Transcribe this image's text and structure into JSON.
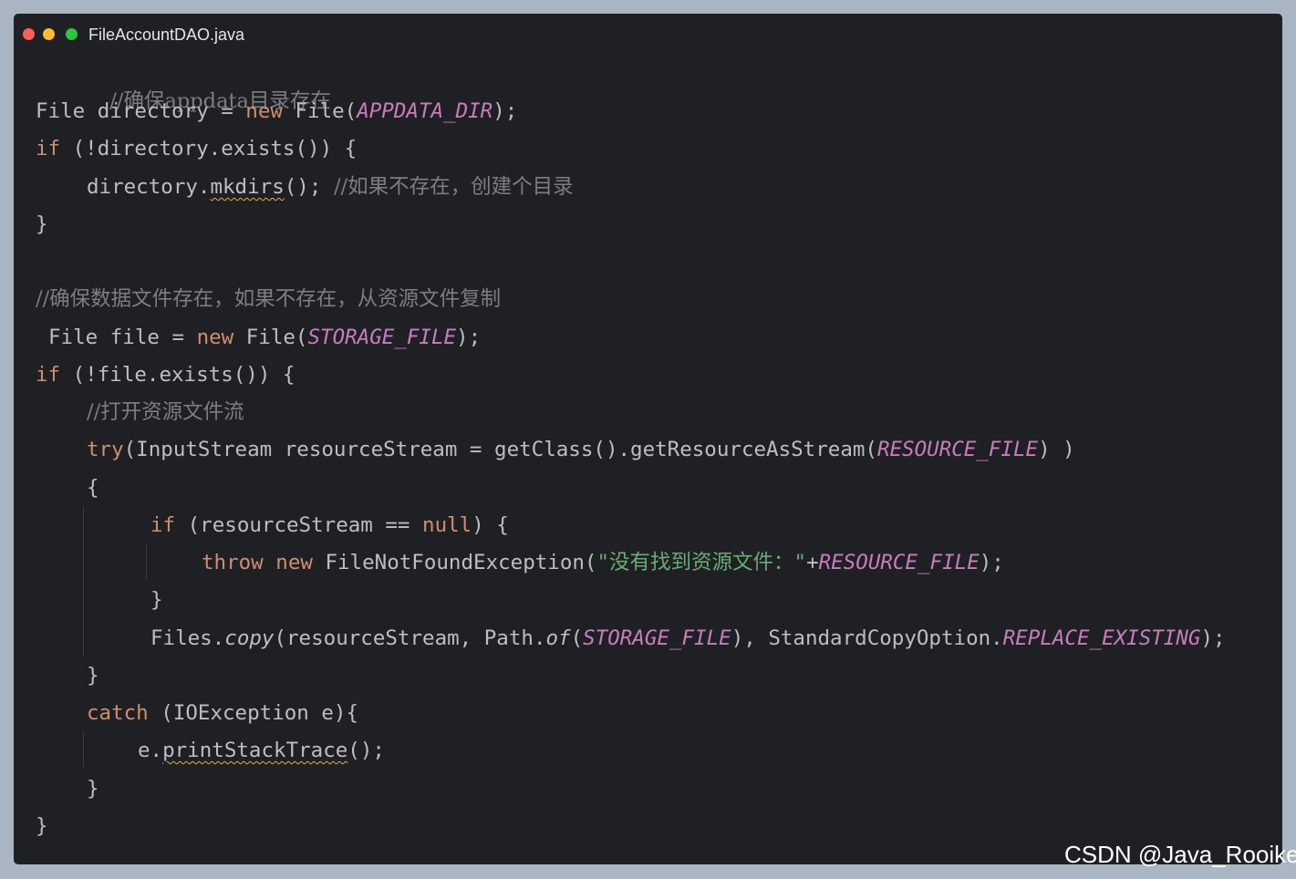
{
  "window": {
    "title": "FileAccountDAO.java"
  },
  "code": {
    "l1_comment": "//确保appdata目录存在",
    "l2_a": "File directory = ",
    "l2_new": "new",
    "l2_b": " File(",
    "l2_const": "APPDATA_DIR",
    "l2_c": ");",
    "l3_if": "if",
    "l3_rest": " (!directory.exists()) {",
    "l4_a": "directory.",
    "l4_method": "mkdirs",
    "l4_b": "(); ",
    "l4_comment": "//如果不存在，创建个目录",
    "l5": "}",
    "l6_comment": "//确保数据文件存在，如果不存在，从资源文件复制",
    "l7_a": "File file = ",
    "l7_new": "new",
    "l7_b": " File(",
    "l7_const": "STORAGE_FILE",
    "l7_c": ");",
    "l8_if": "if",
    "l8_rest": " (!file.exists()) {",
    "l9_comment": "//打开资源文件流",
    "l10_try": "try",
    "l10_a": "(InputStream resourceStream = getClass().getResourceAsStream(",
    "l10_const": "RESOURCE_FILE",
    "l10_b": ") )",
    "l11": "{",
    "l12_if": "if",
    "l12_a": " (resourceStream == ",
    "l12_null": "null",
    "l12_b": ") {",
    "l13_throw": "throw",
    "l13_new": "new",
    "l13_a": " FileNotFoundException(",
    "l13_q1": "\"",
    "l13_str": "没有找到资源文件：",
    "l13_q2": "\"",
    "l13_plus": "+",
    "l13_const": "RESOURCE_FILE",
    "l13_b": ");",
    "l14": "}",
    "l15_a": "Files.",
    "l15_copy": "copy",
    "l15_b": "(resourceStream, Path.",
    "l15_of": "of",
    "l15_c": "(",
    "l15_const1": "STORAGE_FILE",
    "l15_d": "), StandardCopyOption.",
    "l15_const2": "REPLACE_EXISTING",
    "l15_e": ");",
    "l16": "}",
    "l17_catch": "catch",
    "l17_rest": " (IOException e){",
    "l18_a": "e.",
    "l18_method": "printStackTrace",
    "l18_b": "();",
    "l19": "}",
    "l20": "}"
  },
  "watermark": "CSDN @Java_Rooike"
}
